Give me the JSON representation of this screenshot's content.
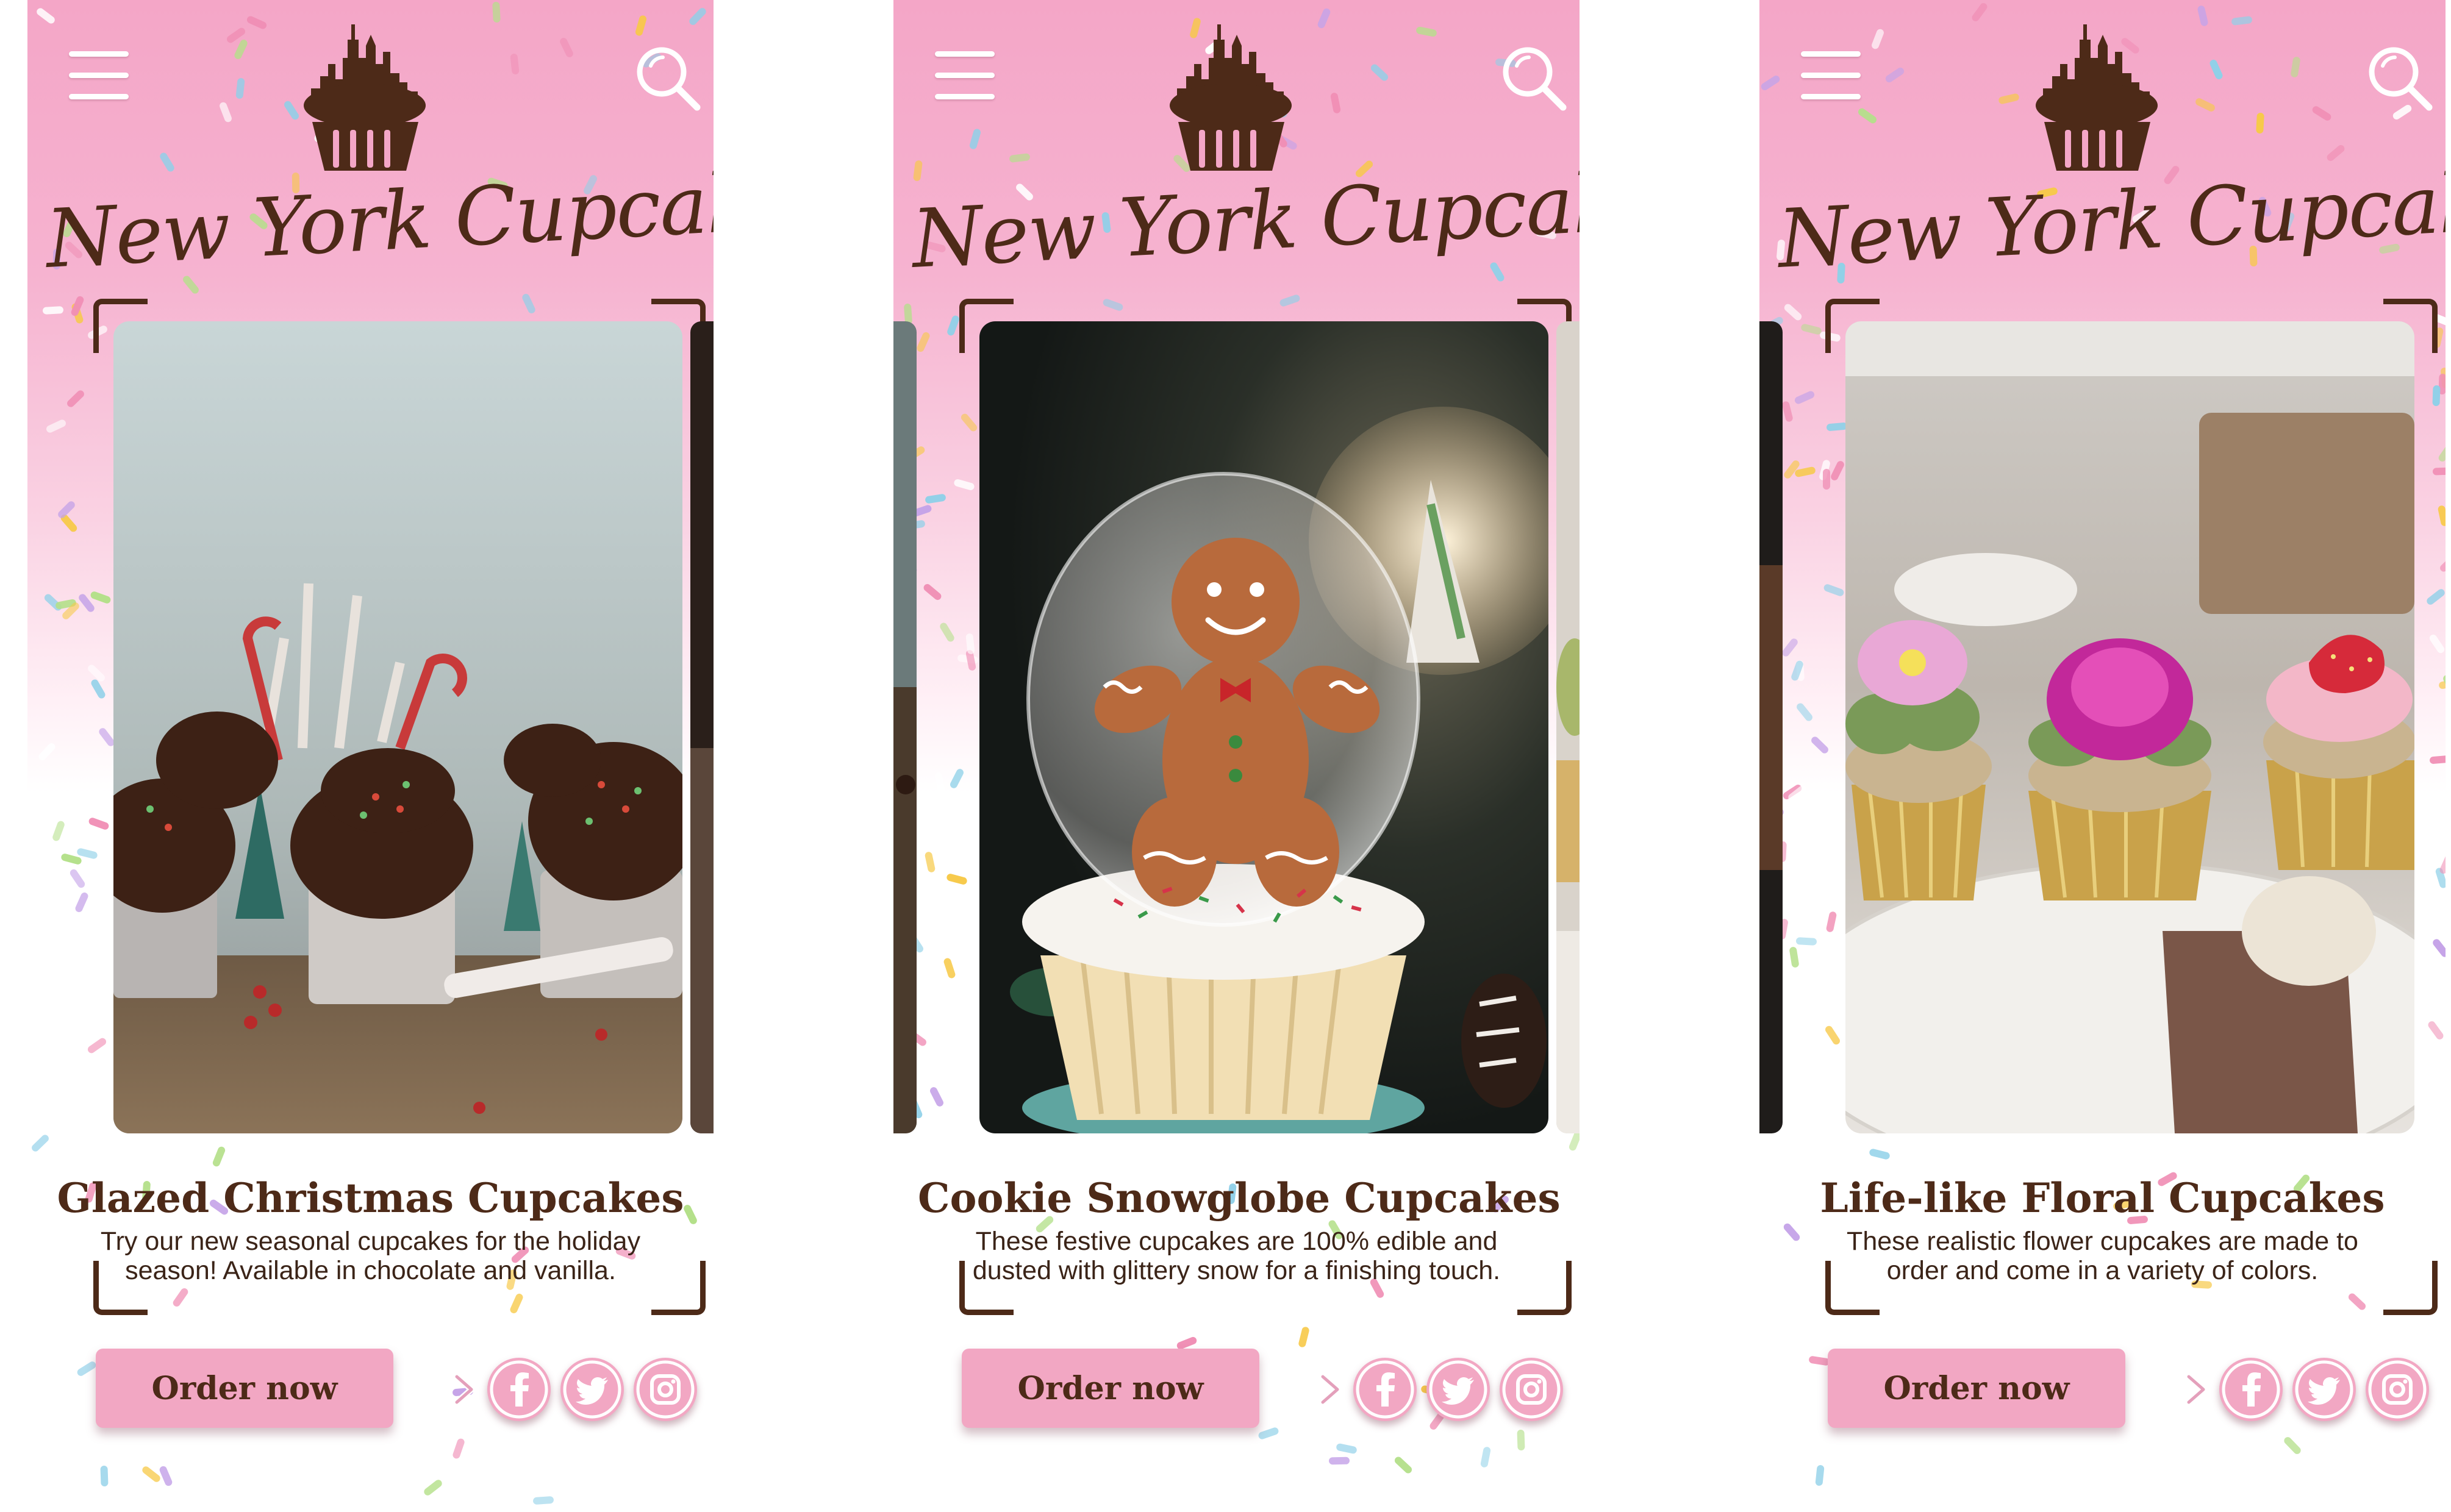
{
  "brand": {
    "name": "New York Cupcakes"
  },
  "header_icons": {
    "menu": "hamburger-menu-icon",
    "search": "search-icon",
    "logo": "cupcake-skyline-logo-icon"
  },
  "screens": [
    {
      "title": "Glazed Christmas Cupcakes",
      "description": "Try our new seasonal cupcakes for the holiday\nseason! Available in chocolate and vanilla.",
      "cta_label": "Order now"
    },
    {
      "title": "Cookie Snowglobe Cupcakes",
      "description": "These festive cupcakes are 100% edible and\ndusted with glittery snow for a finishing touch.",
      "cta_label": "Order now"
    },
    {
      "title": "Life-like Floral Cupcakes",
      "description": "These realistic flower cupcakes are made to\norder and come in a variety of colors.",
      "cta_label": "Order now"
    }
  ],
  "social": [
    "facebook-icon",
    "twitter-icon",
    "instagram-icon"
  ],
  "colors": {
    "header_pink": "#f4a6c7",
    "button_pink": "#f2a7c3",
    "brown": "#4d2a18",
    "white": "#ffffff"
  }
}
